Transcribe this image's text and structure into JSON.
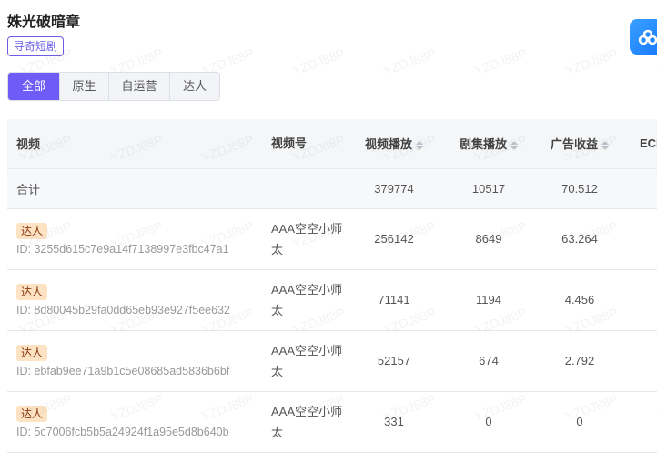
{
  "title": "姝光破暗章",
  "tag": "寻奇短剧",
  "tabs": [
    {
      "label": "全部",
      "active": true
    },
    {
      "label": "原生"
    },
    {
      "label": "自运营"
    },
    {
      "label": "达人"
    }
  ],
  "watermark": "YZDJ88P",
  "table": {
    "headers": [
      "视频",
      "视频号",
      "视频播放",
      "剧集播放",
      "广告收益",
      "ECPM"
    ],
    "sum": {
      "label": "合计",
      "video_plays": "379774",
      "episode_plays": "10517",
      "ad_revenue": "70.512"
    },
    "rows": [
      {
        "badge": "达人",
        "id": "ID: 3255d615c7e9a14f7138997e3fbc47a1",
        "account": "AAA空空小师太",
        "video_plays": "256142",
        "episode_plays": "8649",
        "ad_revenue": "63.264"
      },
      {
        "badge": "达人",
        "id": "ID: 8d80045b29fa0dd65eb93e927f5ee632",
        "account": "AAA空空小师太",
        "video_plays": "71141",
        "episode_plays": "1194",
        "ad_revenue": "4.456"
      },
      {
        "badge": "达人",
        "id": "ID: ebfab9ee71a9b1c5e08685ad5836b6bf",
        "account": "AAA空空小师太",
        "video_plays": "52157",
        "episode_plays": "674",
        "ad_revenue": "2.792"
      },
      {
        "badge": "达人",
        "id": "ID: 5c7006fcb5b5a24924f1a95e5d8b640b",
        "account": "AAA空空小师太",
        "video_plays": "331",
        "episode_plays": "0",
        "ad_revenue": "0"
      }
    ]
  }
}
